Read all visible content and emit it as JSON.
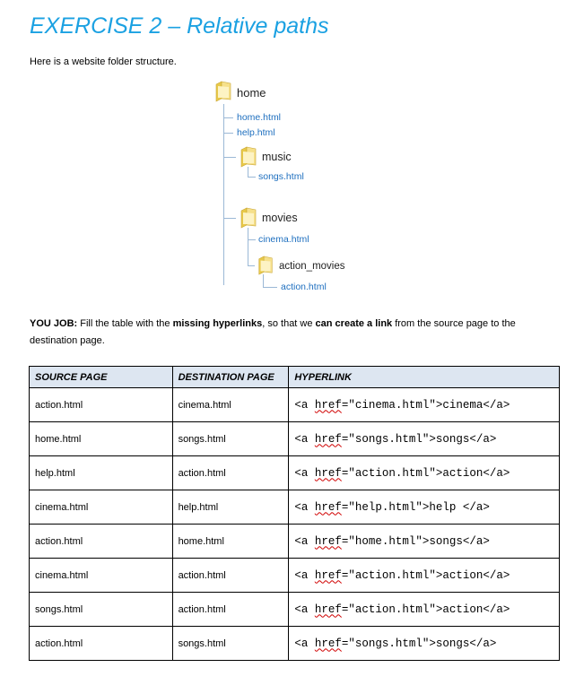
{
  "title": "EXERCISE 2 – Relative paths",
  "intro": "Here is a website folder structure.",
  "tree": {
    "root": "home",
    "root_files": [
      "home.html",
      "help.html"
    ],
    "music": {
      "name": "music",
      "files": [
        "songs.html"
      ]
    },
    "movies": {
      "name": "movies",
      "files": [
        "cinema.html"
      ]
    },
    "action_movies": {
      "name": "action_movies",
      "files": [
        "action.html"
      ]
    }
  },
  "instructions": {
    "label": "YOU JOB:",
    "t1": " Fill the table with the ",
    "b1": "missing hyperlinks",
    "t2": ", so that we ",
    "b2": "can create a link",
    "t3": " from the source page to the destination page."
  },
  "table": {
    "headers": [
      "SOURCE PAGE",
      "DESTINATION PAGE",
      "HYPERLINK"
    ],
    "rows": [
      {
        "source": "action.html",
        "destination": "cinema.html",
        "hl_pre": "<a ",
        "hl_attr": "href",
        "hl_post": "=\"cinema.html\">cinema</a>"
      },
      {
        "source": "home.html",
        "destination": "songs.html",
        "hl_pre": "<a ",
        "hl_attr": "href",
        "hl_post": "=\"songs.html\">songs</a>"
      },
      {
        "source": "help.html",
        "destination": "action.html",
        "hl_pre": "<a ",
        "hl_attr": "href",
        "hl_post": "=\"action.html\">action</a>"
      },
      {
        "source": "cinema.html",
        "destination": "help.html",
        "hl_pre": "<a ",
        "hl_attr": "href",
        "hl_post": "=\"help.html\">help </a>"
      },
      {
        "source": "action.html",
        "destination": "home.html",
        "hl_pre": "<a ",
        "hl_attr": "href",
        "hl_post": "=\"home.html\">songs</a>"
      },
      {
        "source": "cinema.html",
        "destination": "action.html",
        "hl_pre": "<a ",
        "hl_attr": "href",
        "hl_post": "=\"action.html\">action</a>"
      },
      {
        "source": "songs.html",
        "destination": "action.html",
        "hl_pre": "<a ",
        "hl_attr": "href",
        "hl_post": "=\"action.html\">action</a>"
      },
      {
        "source": "action.html",
        "destination": "songs.html",
        "hl_pre": "<a ",
        "hl_attr": "href",
        "hl_post": "=\"songs.html\">songs</a>"
      }
    ]
  },
  "colors": {
    "title": "#1ba1e2",
    "file_link": "#1e6fbf",
    "header_bg": "#dde6f1",
    "spell_squiggle": "#d00000"
  },
  "icons": {
    "folder": "folder-icon"
  }
}
